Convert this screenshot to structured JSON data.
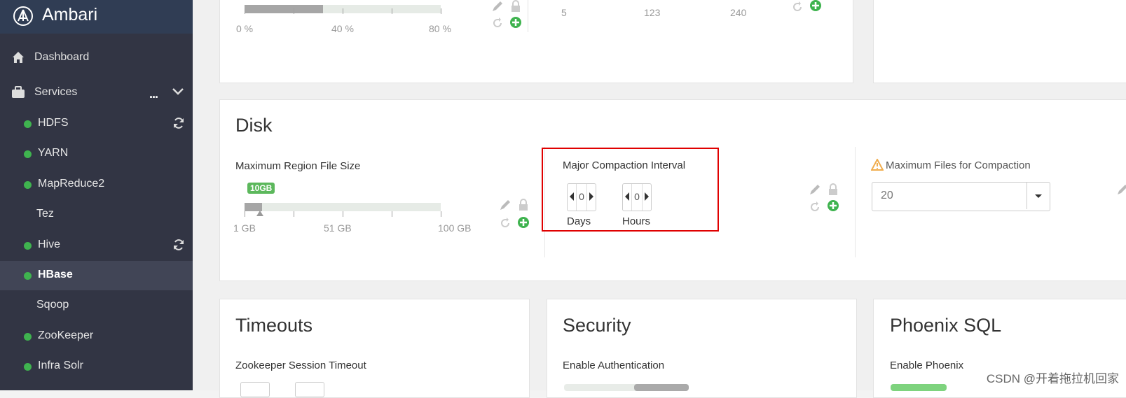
{
  "brand": {
    "name": "Ambari"
  },
  "sidebar": {
    "dashboard": "Dashboard",
    "services": "Services",
    "services_more": "...",
    "items": [
      {
        "label": "HDFS",
        "status": "running",
        "refresh": true
      },
      {
        "label": "YARN",
        "status": "running",
        "refresh": false
      },
      {
        "label": "MapReduce2",
        "status": "running",
        "refresh": false
      },
      {
        "label": "Tez",
        "status": "none",
        "refresh": false
      },
      {
        "label": "Hive",
        "status": "running",
        "refresh": true
      },
      {
        "label": "HBase",
        "status": "running",
        "refresh": false,
        "active": true
      },
      {
        "label": "Sqoop",
        "status": "none",
        "refresh": false
      },
      {
        "label": "ZooKeeper",
        "status": "running",
        "refresh": false
      },
      {
        "label": "Infra Solr",
        "status": "running",
        "refresh": false
      }
    ]
  },
  "top_row": {
    "slider_labels": [
      "0 %",
      "40 %",
      "80 %"
    ],
    "slider_value_fraction": 0.4,
    "mid_labels": [
      "5",
      "123",
      "240"
    ]
  },
  "disk": {
    "title": "Disk",
    "region": {
      "label": "Maximum Region File Size",
      "badge": "10GB",
      "value_fraction": 0.09,
      "ticks": [
        "1 GB",
        "51 GB",
        "100 GB"
      ]
    },
    "compaction": {
      "label": "Major Compaction Interval",
      "days_value": "0",
      "days_label": "Days",
      "hours_value": "0",
      "hours_label": "Hours"
    },
    "max_files": {
      "label": "Maximum Files for Compaction",
      "value": "20"
    }
  },
  "bottom": {
    "timeouts": {
      "title": "Timeouts",
      "field": "Zookeeper Session Timeout"
    },
    "security": {
      "title": "Security",
      "field": "Enable Authentication"
    },
    "phoenix": {
      "title": "Phoenix SQL",
      "field": "Enable Phoenix"
    }
  },
  "watermark": "CSDN @开着拖拉机回家",
  "colors": {
    "accent_green": "#3fb34f",
    "highlight_red": "#e00000",
    "sidebar_bg": "#323544"
  }
}
